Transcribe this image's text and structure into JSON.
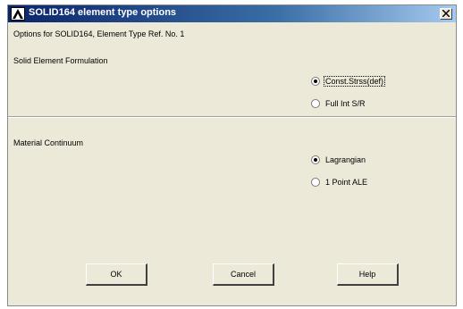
{
  "window": {
    "title": "SOLID164 element type options"
  },
  "header": {
    "options_label": "Options for SOLID164, Element Type Ref. No. 1"
  },
  "formulation": {
    "label": "Solid Element Formulation",
    "options": [
      {
        "label": "Const.Strss(def)",
        "checked": true
      },
      {
        "label": "Full Int S/R",
        "checked": false
      }
    ]
  },
  "continuum": {
    "label": "Material Continuum",
    "options": [
      {
        "label": "Lagrangian",
        "checked": true
      },
      {
        "label": "1 Point ALE",
        "checked": false
      }
    ]
  },
  "buttons": {
    "ok": "OK",
    "cancel": "Cancel",
    "help": "Help"
  },
  "colors": {
    "titlebar_start": "#0a246a",
    "dialog_bg": "#ece9d8"
  },
  "icons": {
    "app": "ansys-logo-icon",
    "close": "close-icon"
  }
}
